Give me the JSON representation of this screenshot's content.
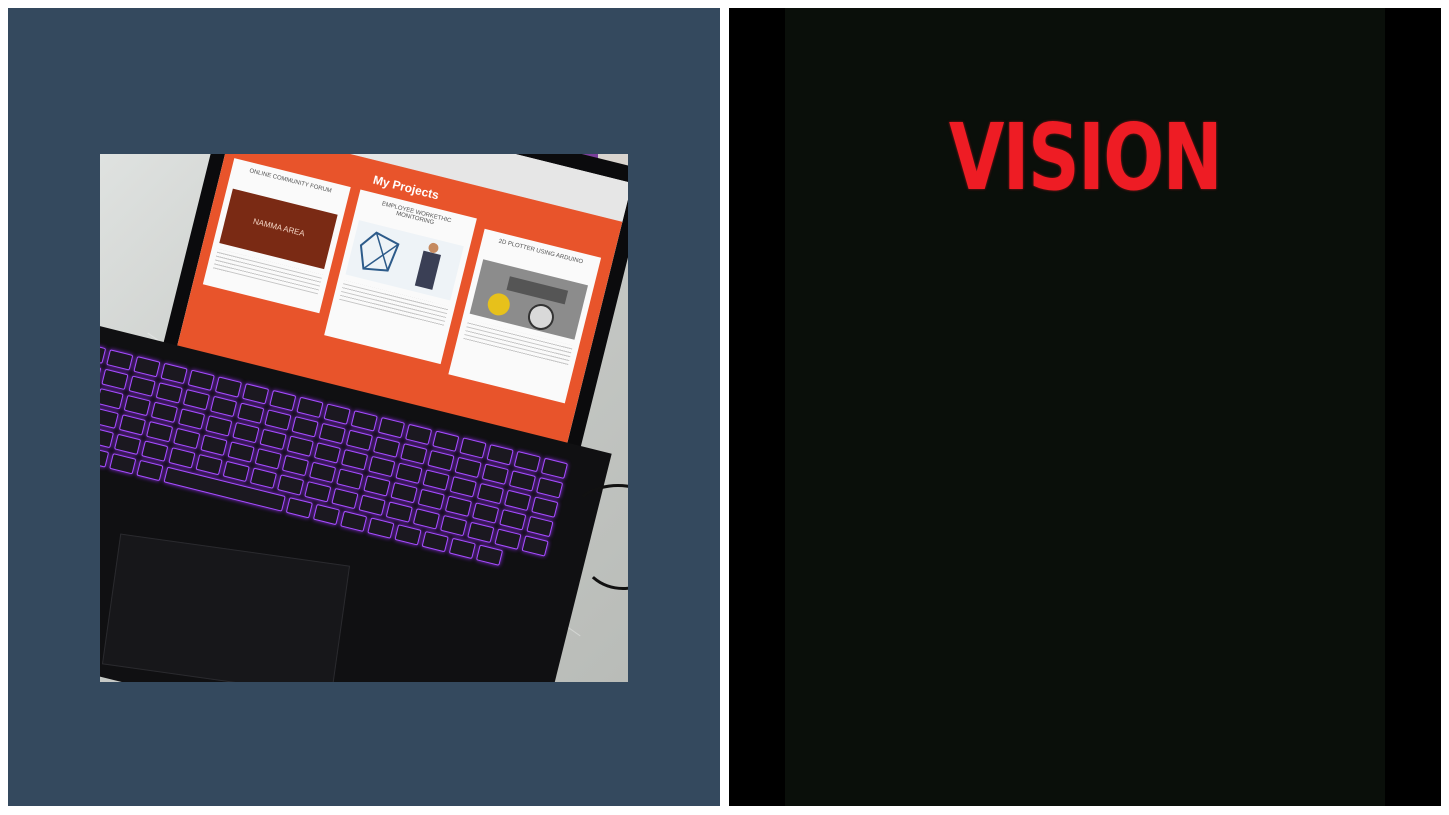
{
  "left_panel": {
    "background": "#34495e",
    "photo": {
      "subject": "laptop-photo",
      "screen": {
        "section_title": "My Projects",
        "cards": [
          {
            "title": "ONLINE COMMUNITY FORUM",
            "accent": "#b5461f"
          },
          {
            "title": "EMPLOYEE WORKETHIC MONITORING",
            "accent": "#d9e6f0"
          },
          {
            "title": "2D PLOTTER USING ARDUINO",
            "accent": "#8c8c8c"
          }
        ],
        "card_banner": "NAMMA AREA"
      }
    }
  },
  "right_panel": {
    "background": "#0a0f0a",
    "title": "VISION",
    "title_color": "#ee1c24"
  }
}
